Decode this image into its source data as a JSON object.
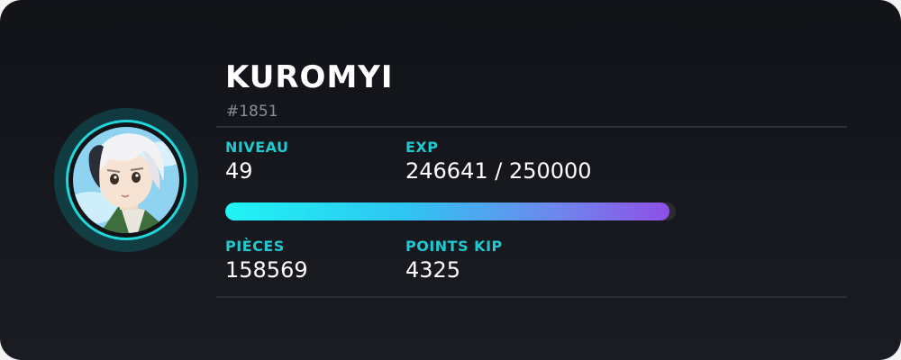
{
  "profile": {
    "username": "KUROMYI",
    "discriminator": "#1851",
    "avatar_icon": "anime-character-avatar-icon"
  },
  "stats": {
    "level_label": "NIVEAU",
    "level_value": "49",
    "exp_label": "EXP",
    "exp_value": "246641 / 250000",
    "exp_current": 246641,
    "exp_max": 250000,
    "coins_label": "PIÈCES",
    "coins_value": "158569",
    "kip_label": "POINTS KIP",
    "kip_value": "4325"
  },
  "colors": {
    "accent": "#1fc9cf",
    "ring": "#1fd6d9",
    "progress_start": "#1ff4f4",
    "progress_end": "#8f4fe6",
    "background": "#111318"
  }
}
